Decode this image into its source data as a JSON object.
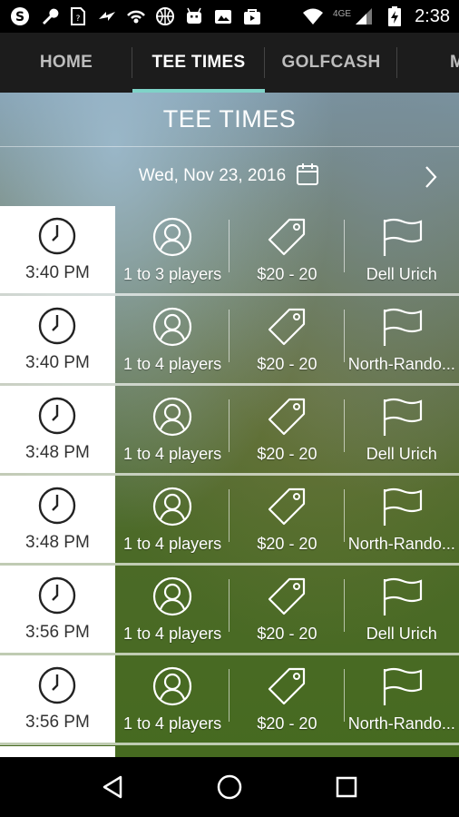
{
  "status_bar": {
    "time": "2:38",
    "network_label": "4GE",
    "left_icons": [
      "skype-icon",
      "wrench-icon",
      "sim-icon",
      "bolt-icon",
      "hotspot-icon",
      "basketball-icon",
      "android-icon",
      "photo-icon",
      "bag-icon"
    ],
    "right_icons": [
      "wifi-icon",
      "signal-icon",
      "battery-charging-icon"
    ]
  },
  "tabs": [
    {
      "label": "HOME",
      "active": false
    },
    {
      "label": "TEE TIMES",
      "active": true
    },
    {
      "label": "GOLFCASH",
      "active": false
    },
    {
      "label": "M",
      "active": false
    }
  ],
  "page_title": "TEE TIMES",
  "date": "Wed, Nov 23, 2016",
  "tee_times": [
    {
      "time": "3:40 PM",
      "players": "1 to 3 players",
      "price": "$20 - 20",
      "course": "Dell Urich"
    },
    {
      "time": "3:40 PM",
      "players": "1 to 4 players",
      "price": "$20 - 20",
      "course": "North-Rando..."
    },
    {
      "time": "3:48 PM",
      "players": "1 to 4 players",
      "price": "$20 - 20",
      "course": "Dell Urich"
    },
    {
      "time": "3:48 PM",
      "players": "1 to 4 players",
      "price": "$20 - 20",
      "course": "North-Rando..."
    },
    {
      "time": "3:56 PM",
      "players": "1 to 4 players",
      "price": "$20 - 20",
      "course": "Dell Urich"
    },
    {
      "time": "3:56 PM",
      "players": "1 to 4 players",
      "price": "$20 - 20",
      "course": "North-Rando..."
    }
  ],
  "colors": {
    "tab_indicator": "#7fd3c8",
    "navbar_bg": "#1c1c1c"
  }
}
